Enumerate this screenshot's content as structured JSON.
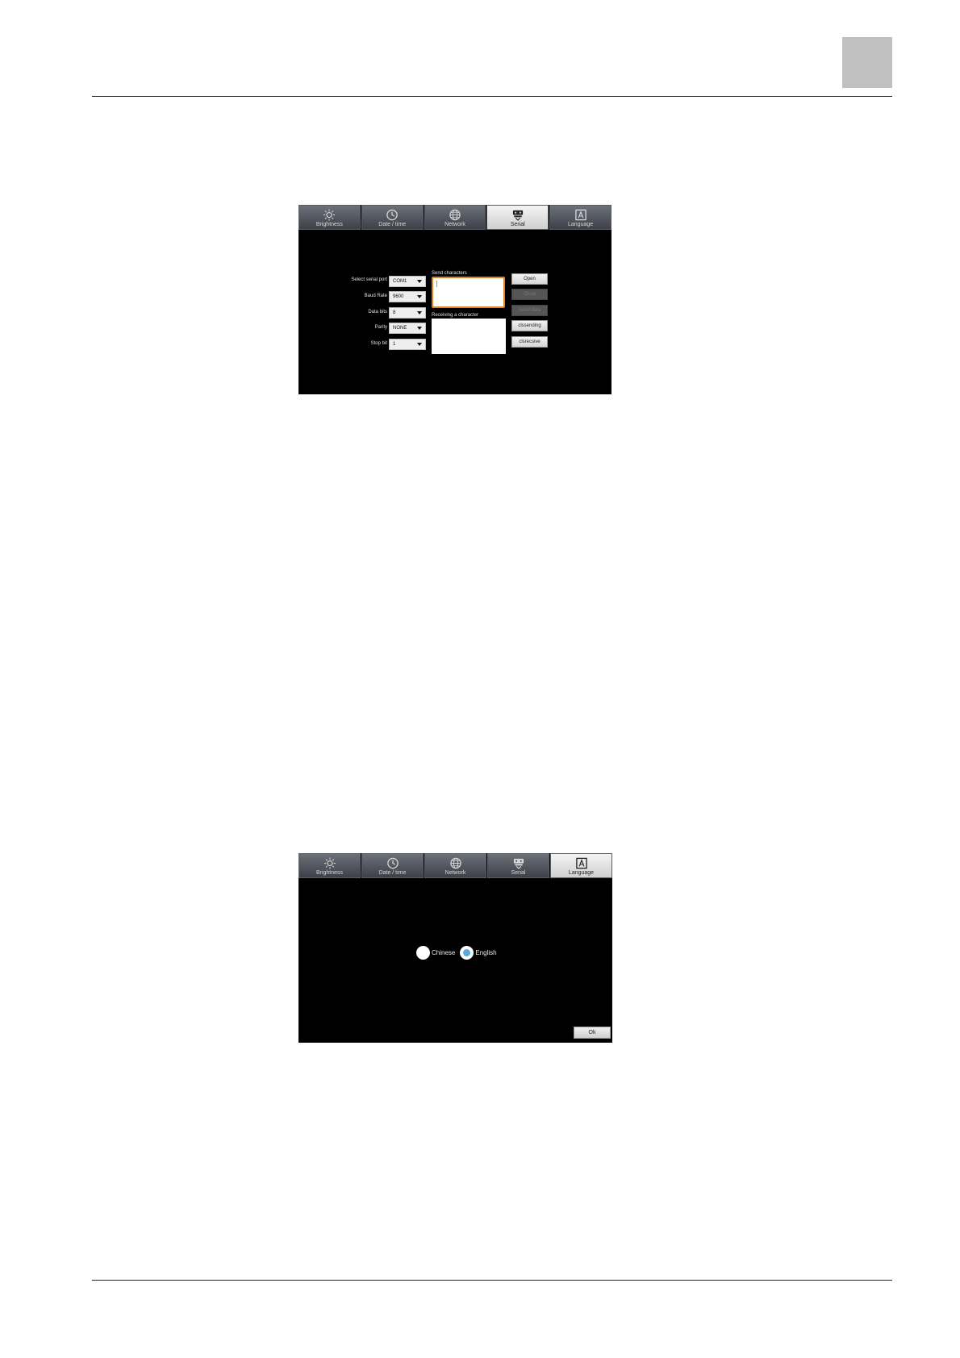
{
  "tabs": [
    {
      "id": "brightness",
      "label": "Brightness",
      "icon": "sun-icon"
    },
    {
      "id": "datetime",
      "label": "Date / time",
      "icon": "clock-icon"
    },
    {
      "id": "network",
      "label": "Network",
      "icon": "globe-icon"
    },
    {
      "id": "serial",
      "label": "Serial",
      "icon": "serial-port-icon"
    },
    {
      "id": "language",
      "label": "Language",
      "icon": "language-icon"
    }
  ],
  "serial_screen": {
    "active_tab": "serial",
    "fields": [
      {
        "label": "Select serial port",
        "value": "COM1"
      },
      {
        "label": "Baud Rate",
        "value": "9600"
      },
      {
        "label": "Data bits",
        "value": "8"
      },
      {
        "label": "Parity",
        "value": "NONE"
      },
      {
        "label": "Stop bit",
        "value": "1"
      }
    ],
    "send_label": "Send characters",
    "send_value": "",
    "receive_label": "Receiving a character",
    "receive_value": "",
    "buttons": [
      {
        "label": "Open",
        "enabled": true
      },
      {
        "label": "Close",
        "enabled": false
      },
      {
        "label": "Send data",
        "enabled": false
      },
      {
        "label": "clssending",
        "enabled": true
      },
      {
        "label": "clsrecsive",
        "enabled": true
      }
    ],
    "send_border_color": "#e2811f"
  },
  "language_screen": {
    "active_tab": "language",
    "options": [
      {
        "label": "Chinese",
        "checked": false
      },
      {
        "label": "English",
        "checked": true
      }
    ],
    "ok_label": "Ok",
    "radio_accent": "#5aa8dc"
  }
}
